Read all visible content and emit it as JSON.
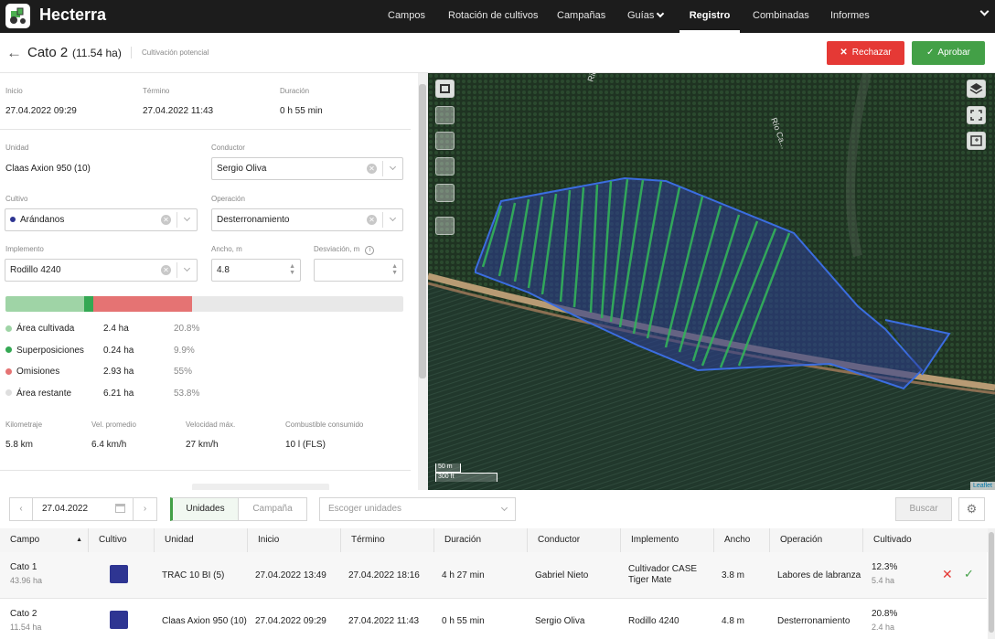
{
  "app": {
    "brand": "Hecterra"
  },
  "nav": [
    {
      "label": "Campos"
    },
    {
      "label": "Rotación de cultivos"
    },
    {
      "label": "Campañas"
    },
    {
      "label": "Guías"
    },
    {
      "label": "Registro"
    },
    {
      "label": "Combinadas"
    },
    {
      "label": "Informes"
    }
  ],
  "header": {
    "field": "Cato 2",
    "area": "(11.54 ha)",
    "subtitle": "Cultivación potencial",
    "reject": "Rechazar",
    "approve": "Aprobar"
  },
  "summary": {
    "start_label": "Inicio",
    "start": "27.04.2022 09:29",
    "end_label": "Término",
    "end": "27.04.2022 11:43",
    "duration_label": "Duración",
    "duration": "0 h 55 min"
  },
  "form": {
    "unit_label": "Unidad",
    "unit": "Claas Axion 950 (10)",
    "driver_label": "Conductor",
    "driver": "Sergio Oliva",
    "crop_label": "Cultivo",
    "crop": "Arándanos",
    "crop_color": "#2e3592",
    "operation_label": "Operación",
    "operation": "Desterronamiento",
    "implement_label": "Implemento",
    "implement": "Rodillo 4240",
    "width_label": "Ancho, m",
    "width": "4.8",
    "deviation_label": "Desviación, m",
    "deviation": ""
  },
  "coverage": {
    "bar": [
      {
        "name": "Área cultivada",
        "fraction": 0.198,
        "color": "#9fd4a6"
      },
      {
        "name": "Superposiciones",
        "fraction": 0.022,
        "color": "#34a853"
      },
      {
        "name": "Omisiones",
        "fraction": 0.25,
        "color": "#e57373"
      },
      {
        "name": "Área restante",
        "fraction": 0.53,
        "color": "#e8e8e8"
      }
    ],
    "legend": [
      {
        "label": "Área cultivada",
        "value": "2.4 ha",
        "pct": "20.8%",
        "color": "#9fd4a6"
      },
      {
        "label": "Superposiciones",
        "value": "0.24 ha",
        "pct": "9.9%",
        "color": "#34a853"
      },
      {
        "label": "Omisiones",
        "value": "2.93 ha",
        "pct": "55%",
        "color": "#e57373"
      },
      {
        "label": "Área restante",
        "value": "6.21 ha",
        "pct": "53.8%",
        "color": "#dedede"
      }
    ]
  },
  "stats": [
    {
      "label": "Kilometraje",
      "value": "5.8 km"
    },
    {
      "label": "Vel. promedio",
      "value": "6.4 km/h"
    },
    {
      "label": "Velocidad máx.",
      "value": "27 km/h"
    },
    {
      "label": "Combustible consumido",
      "value": "10 l (FLS)"
    }
  ],
  "map": {
    "scale_m": "50 m",
    "scale_ft": "300 ft",
    "attribution": "Leaflet"
  },
  "filters": {
    "date": "27.04.2022",
    "tab_units": "Unidades",
    "tab_campaign": "Campaña",
    "select_placeholder": "Escoger unidades",
    "search": "Buscar"
  },
  "table": {
    "headers": [
      "Campo",
      "Cultivo",
      "Unidad",
      "Inicio",
      "Término",
      "Duración",
      "Conductor",
      "Implemento",
      "Ancho",
      "Operación",
      "Cultivado"
    ],
    "rows": [
      {
        "field": "Cato 1",
        "field_area": "43.96 ha",
        "crop_color": "#2e3592",
        "unit": "TRAC 10 BI (5)",
        "start": "27.04.2022 13:49",
        "end": "27.04.2022 18:16",
        "duration": "4 h 27 min",
        "driver": "Gabriel Nieto",
        "implement": "Cultivador CASE Tiger Mate",
        "width": "3.8 m",
        "operation": "Labores de labranza",
        "cultivated_pct": "12.3%",
        "cultivated_ha": "5.4 ha"
      },
      {
        "field": "Cato 2",
        "field_area": "11.54 ha",
        "crop_color": "#2e3592",
        "unit": "Claas Axion 950 (10)",
        "start": "27.04.2022 09:29",
        "end": "27.04.2022 11:43",
        "duration": "0 h 55 min",
        "driver": "Sergio Oliva",
        "implement": "Rodillo 4240",
        "width": "4.8 m",
        "operation": "Desterronamiento",
        "cultivated_pct": "20.8%",
        "cultivated_ha": "2.4 ha"
      }
    ]
  }
}
